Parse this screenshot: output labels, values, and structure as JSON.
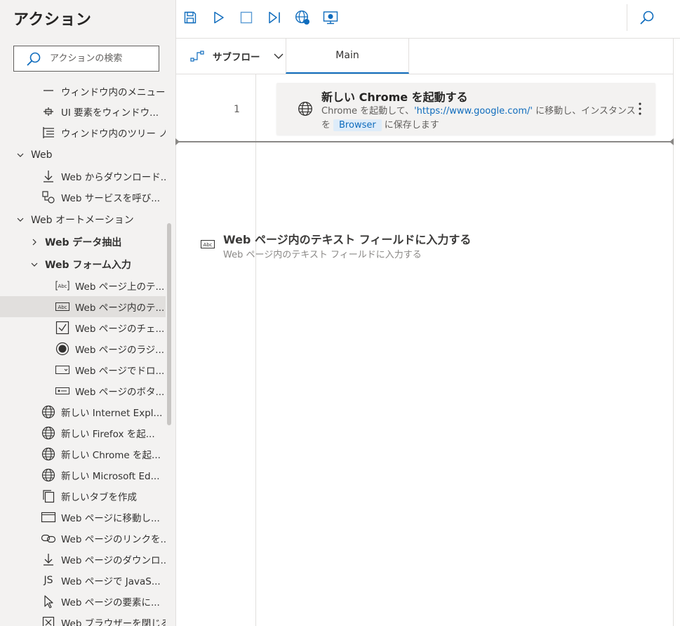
{
  "sidebar": {
    "title": "アクション",
    "search_placeholder": "アクションの検索",
    "items": [
      {
        "label": "ウィンドウ内のメニュー...",
        "icon": "menu-icon"
      },
      {
        "label": "UI 要素をウィンドウ...",
        "icon": "element-icon"
      },
      {
        "label": "ウィンドウ内のツリー ノ...",
        "icon": "tree-icon"
      },
      {
        "label": "Web",
        "icon": "chevron-down-icon"
      },
      {
        "label": "Web からダウンロード...",
        "icon": "download-icon"
      },
      {
        "label": "Web サービスを呼び...",
        "icon": "web-service-icon"
      },
      {
        "label": "Web オートメーション",
        "icon": "chevron-down-icon"
      },
      {
        "label": "Web データ抽出",
        "icon": "chevron-right-icon"
      },
      {
        "label": "Web フォーム入力",
        "icon": "chevron-down-icon"
      },
      {
        "label": "Web ページ上のテ...",
        "icon": "text-field-icon"
      },
      {
        "label": "Web ページ内のテ...",
        "icon": "textbox-icon"
      },
      {
        "label": "Web ページのチェ...",
        "icon": "checkbox-icon"
      },
      {
        "label": "Web ページのラジ...",
        "icon": "radio-icon"
      },
      {
        "label": "Web ページでドロ...",
        "icon": "dropdown-icon"
      },
      {
        "label": "Web ページのボタ...",
        "icon": "button-icon"
      },
      {
        "label": "新しい Internet Expl...",
        "icon": "globe-icon"
      },
      {
        "label": "新しい Firefox を起...",
        "icon": "globe-icon"
      },
      {
        "label": "新しい Chrome を起...",
        "icon": "globe-icon"
      },
      {
        "label": "新しい Microsoft Ed...",
        "icon": "globe-icon"
      },
      {
        "label": "新しいタブを作成",
        "icon": "new-tab-icon"
      },
      {
        "label": "Web ページに移動し...",
        "icon": "window-icon"
      },
      {
        "label": "Web ページのリンクを...",
        "icon": "link-icon"
      },
      {
        "label": "Web ページのダウンロ...",
        "icon": "download-icon"
      },
      {
        "label": "Web ページで JavaS...",
        "icon": "js-icon"
      },
      {
        "label": "Web ページの要素に...",
        "icon": "cursor-icon"
      },
      {
        "label": "Web ブラウザーを閉じる",
        "icon": "close-box-icon"
      }
    ],
    "js_glyph": "JS"
  },
  "toolbar": {
    "buttons": [
      "save-icon",
      "run-icon",
      "stop-icon",
      "step-icon",
      "web-recorder-icon",
      "desktop-recorder-icon",
      "search-icon"
    ]
  },
  "tabs": {
    "subflow_label": "サブフロー",
    "main_label": "Main"
  },
  "flow": {
    "line_number": "1",
    "action": {
      "title": "新しい Chrome を起動する",
      "desc_prefix": "Chrome を起動して、",
      "desc_url": "'https://www.google.com/'",
      "desc_middle": " に移動し、インスタンスを",
      "desc_variable": "Browser",
      "desc_suffix": "に保存します"
    },
    "drag_ghost": {
      "title": "Web ページ内のテキスト フィールドに入力する",
      "desc": "Web ページ内のテキスト フィールドに入力する",
      "icon_text": "Abc"
    }
  },
  "colors": {
    "accent": "#0f6cbd",
    "sidebar_bg": "#f3f2f1",
    "selected_bg": "#e1dfdd"
  }
}
